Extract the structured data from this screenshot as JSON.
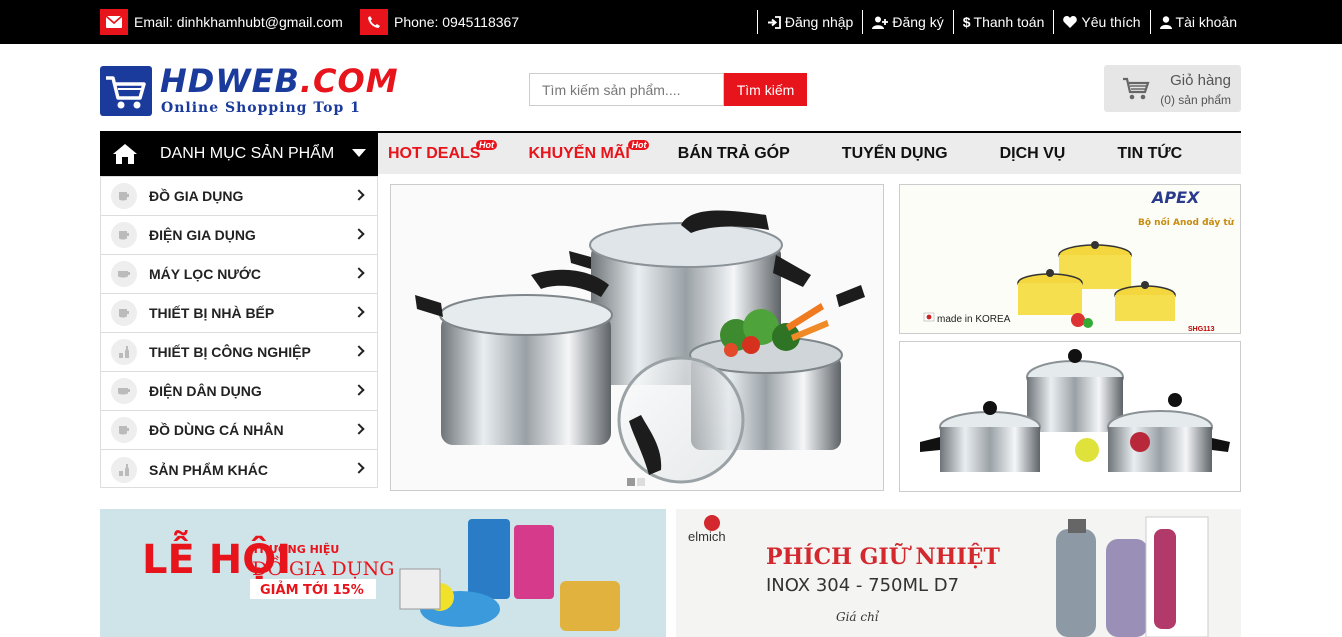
{
  "topbar": {
    "email": "Email: dinhkhamhubt@gmail.com",
    "phone": "Phone: 0945118367",
    "links": [
      {
        "icon": "sign-in-icon",
        "label": "Đăng nhập"
      },
      {
        "icon": "user-plus-icon",
        "label": "Đăng ký"
      },
      {
        "icon": "dollar-icon",
        "label": "Thanh toán"
      },
      {
        "icon": "heart-icon",
        "label": "Yêu thích"
      },
      {
        "icon": "user-icon",
        "label": "Tài khoản"
      }
    ]
  },
  "header": {
    "brand": "HDWEB",
    "brand_suffix": ".COM",
    "tagline": "Online Shopping Top 1",
    "search_placeholder": "Tìm kiếm sản phẩm....",
    "search_button": "Tìm kiếm",
    "cart_title": "Giỏ hàng",
    "cart_count": "(0) sản phẩm"
  },
  "nav": {
    "category_label": "DANH MỤC SẢN PHẨM",
    "hot_badge": "Hot",
    "links": [
      "HOT DEALS",
      "KHUYẾN MÃI",
      "BÁN TRẢ GÓP",
      "TUYỂN DỤNG",
      "DỊCH VỤ",
      "TIN TỨC"
    ]
  },
  "sidebar": {
    "items": [
      "ĐỒ GIA DỤNG",
      "ĐIỆN GIA DỤNG",
      "MÁY LỌC NƯỚC",
      "THIẾT BỊ NHÀ BẾP",
      "THIẾT BỊ CÔNG NGHIỆP",
      "ĐIỆN DÂN DỤNG",
      "ĐỒ DÙNG CÁ NHÂN",
      "SẢN PHẨM KHÁC"
    ]
  },
  "banners": {
    "apex_brand": "APEX",
    "apex_title": "Bộ nồi Anod đáy từ",
    "apex_made": "made in KOREA",
    "apex_code": "SHG113",
    "promo1_line1": "LỄ HỘI",
    "promo1_line2": "THƯƠNG HIỆU",
    "promo1_line3": "ĐỒ GIA DỤNG",
    "promo1_discount": "GIẢM TỚI 15%",
    "promo2_brand": "elmich",
    "promo2_title": "PHÍCH GIỮ NHIỆT",
    "promo2_sub": "INOX 304 - 750ML D7",
    "promo2_price_label": "Giá chỉ"
  },
  "colors": {
    "accent": "#e8141c",
    "brand": "#1b3b9c",
    "topbar": "#000000"
  }
}
